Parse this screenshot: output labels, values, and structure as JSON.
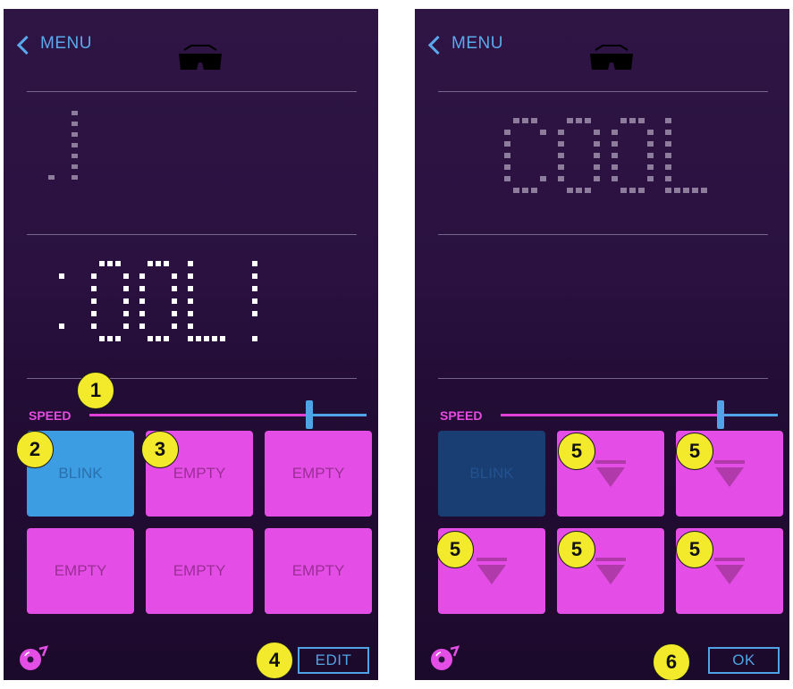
{
  "left": {
    "back_label": "MENU",
    "speed_label": "SPEED",
    "pads": [
      "BLINK",
      "EMPTY",
      "EMPTY",
      "EMPTY",
      "EMPTY",
      "EMPTY"
    ],
    "action_label": "EDIT",
    "badges": [
      "1",
      "2",
      "3",
      "4"
    ]
  },
  "right": {
    "back_label": "MENU",
    "speed_label": "SPEED",
    "first_pad": "BLINK",
    "action_label": "OK",
    "badges": [
      "5",
      "5",
      "5",
      "5",
      "5",
      "6"
    ]
  },
  "speed_value": 0.8,
  "colors": {
    "background": "#2a1140",
    "accent_pink": "#e44ee6",
    "accent_blue": "#4fa3e6",
    "badge_yellow": "#f2ea2a"
  },
  "icons": [
    "chevron-left-icon",
    "glasses-icon",
    "disc-icon",
    "arrow-down-icon"
  ]
}
